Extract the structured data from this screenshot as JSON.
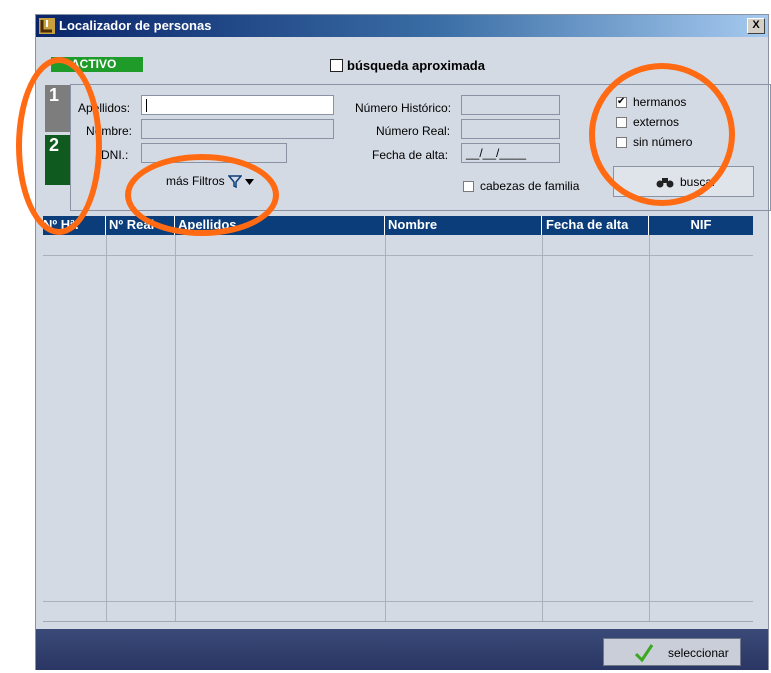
{
  "window": {
    "title": "Localizador de personas",
    "close_label": "X"
  },
  "status_badge": "ACTIVO",
  "approx_search": {
    "label": "búsqueda aproximada",
    "checked": false
  },
  "tabs": [
    {
      "label": "1"
    },
    {
      "label": "2"
    }
  ],
  "fields": {
    "apellidos": {
      "label": "Apellidos:",
      "value": ""
    },
    "nombre": {
      "label": "Nombre:",
      "value": ""
    },
    "dni": {
      "label": "DNI.:",
      "value": ""
    },
    "numero_historico": {
      "label": "Número Histórico:",
      "value": ""
    },
    "numero_real": {
      "label": "Número Real:",
      "value": ""
    },
    "fecha_alta": {
      "label": "Fecha de alta:",
      "value": "__/__/____"
    }
  },
  "mas_filtros": {
    "label": "más Filtros"
  },
  "cabezas_familia": {
    "label": "cabezas de familia",
    "checked": false
  },
  "options": [
    {
      "label": "hermanos",
      "checked": true
    },
    {
      "label": "externos",
      "checked": false
    },
    {
      "label": "sin número",
      "checked": false
    }
  ],
  "buscar_label": "buscar",
  "table": {
    "columns": [
      "Nº Hª.",
      "Nº Real",
      "Apellidos",
      "Nombre",
      "Fecha de alta",
      "NIF"
    ]
  },
  "seleccionar_label": "seleccionar",
  "colors": {
    "accent_orange": "#ff6a13",
    "header_blue": "#0a3d7a",
    "active_green": "#1f9b2a"
  },
  "icons": [
    "app-icon",
    "filter-icon",
    "dropdown-arrow-icon",
    "binoculars-icon",
    "checkmark-icon",
    "close-icon"
  ]
}
